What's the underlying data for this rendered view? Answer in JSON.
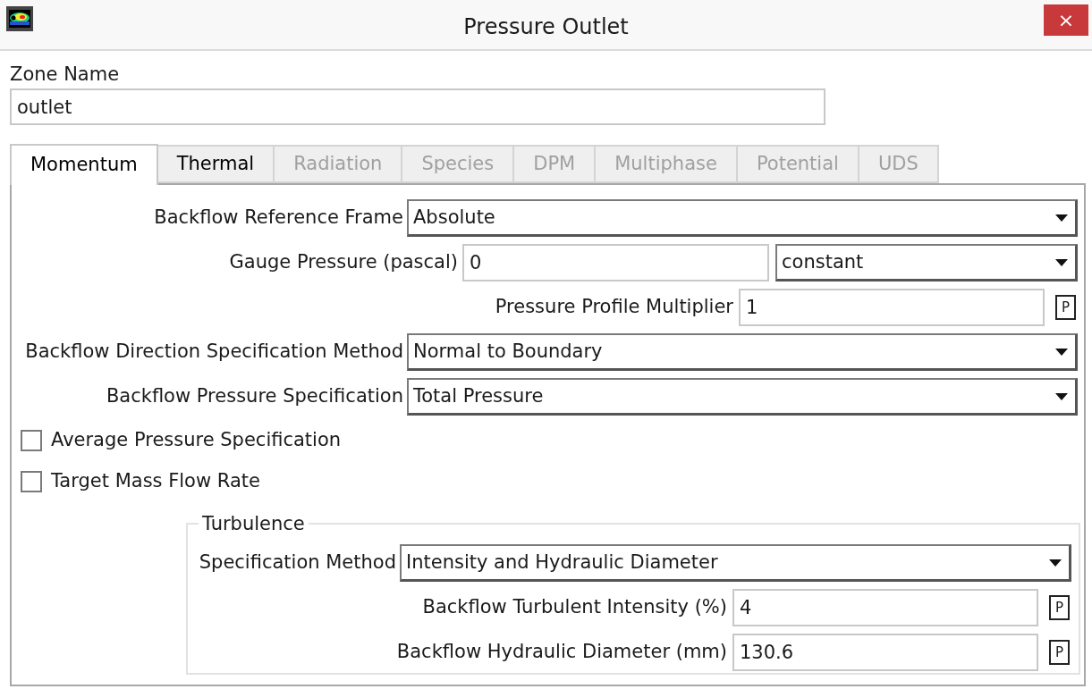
{
  "window": {
    "title": "Pressure Outlet",
    "close": "×"
  },
  "zone_name": {
    "label": "Zone Name",
    "value": "outlet"
  },
  "tabs": [
    {
      "label": "Momentum",
      "selected": true,
      "disabled": false
    },
    {
      "label": "Thermal",
      "selected": false,
      "disabled": false
    },
    {
      "label": "Radiation",
      "selected": false,
      "disabled": true
    },
    {
      "label": "Species",
      "selected": false,
      "disabled": true
    },
    {
      "label": "DPM",
      "selected": false,
      "disabled": true
    },
    {
      "label": "Multiphase",
      "selected": false,
      "disabled": true
    },
    {
      "label": "Potential",
      "selected": false,
      "disabled": true
    },
    {
      "label": "UDS",
      "selected": false,
      "disabled": true
    }
  ],
  "momentum": {
    "rows": [
      {
        "kind": "dropdown",
        "label": "Backflow Reference Frame",
        "value": "Absolute"
      },
      {
        "kind": "value_method",
        "label": "Gauge Pressure (pascal)",
        "value": "0",
        "method": "constant"
      },
      {
        "kind": "parameter",
        "label": "Pressure Profile Multiplier",
        "value": "1",
        "button": "P"
      },
      {
        "kind": "dropdown",
        "label": "Backflow Direction Specification Method",
        "value": "Normal to Boundary"
      },
      {
        "kind": "dropdown",
        "label": "Backflow Pressure Specification",
        "value": "Total Pressure"
      }
    ],
    "options": [
      {
        "label": "Average Pressure Specification",
        "checked": false
      },
      {
        "label": "Target Mass Flow Rate",
        "checked": false
      }
    ],
    "turbulence": {
      "title": "Turbulence",
      "rows": [
        {
          "kind": "dropdown",
          "label": "Specification Method",
          "value": "Intensity and Hydraulic Diameter"
        },
        {
          "kind": "parameter",
          "label": "Backflow Turbulent Intensity (%)",
          "value": "4",
          "button": "P"
        },
        {
          "kind": "parameter",
          "label": "Backflow Hydraulic Diameter (mm)",
          "value": "130.6",
          "button": "P"
        }
      ]
    }
  }
}
